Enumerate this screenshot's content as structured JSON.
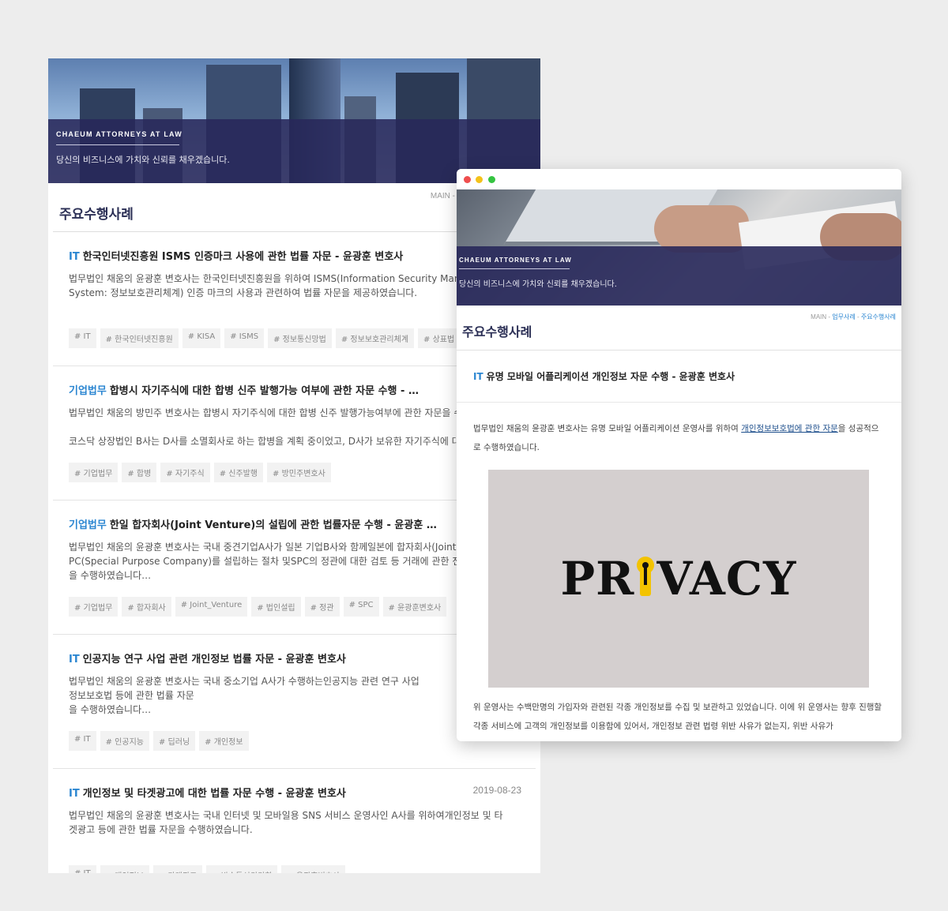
{
  "back": {
    "hero_kicker": "CHAEUM ATTORNEYS AT LAW",
    "hero_tagline": "당신의 비즈니스에 가치와 신뢰를 채우겠습니다.",
    "breadcrumb": "MAIN -",
    "page_title": "주요수행사례",
    "posts": [
      {
        "category": "IT",
        "title": "한국인터넷진흥원 ISMS 인증마크 사용에 관한 법률 자문 - 윤광훈 변호사",
        "date": "",
        "excerpt": "법무법인 채움의 윤광훈 변호사는 한국인터넷진흥원을 위하여 ISMS(Information Security Mana\nSystem: 정보보호관리체계) 인증 마크의 사용과 관련하여 법률 자문을 제공하였습니다.",
        "tags": [
          "# IT",
          "# 한국인터넷진흥원",
          "# KISA",
          "# ISMS",
          "# 정보통신망법",
          "# 정보보호관리체계",
          "# 상표법"
        ]
      },
      {
        "category": "기업법무",
        "title": "합병시 자기주식에 대한 합병 신주 발행가능 여부에 관한 자문 수행 - …",
        "date": "",
        "excerpt": "법무법인 채움의 방민주 변호사는 합병시 자기주식에 대한 합병 신주 발행가능여부에 관한 자문을 수\n\n코스닥 상장법인 B사는 D사를 소멸회사로 하는 합병을 계획 중이었고, D사가 보유한 자기주식에 대",
        "tags": [
          "# 기업법무",
          "# 합병",
          "# 자기주식",
          "# 신주발행",
          "# 방민주변호사"
        ]
      },
      {
        "category": "기업법무",
        "title": "한일 합자회사(Joint Venture)의 설립에 관한 법률자문 수행 - 윤광훈 …",
        "date": "",
        "excerpt": "법무법인 채움의 윤광훈 변호사는 국내 중견기업A사가 일본 기업B사와 함께일본에 합자회사(Joint\nPC(Special Purpose Company)를 설립하는 절차 및SPC의 정관에 대한 검토 등 거래에 관한 전반\n을 수행하였습니다…",
        "tags": [
          "# 기업법무",
          "# 합자회사",
          "# Joint_Venture",
          "# 법인설립",
          "# 정관",
          "# SPC",
          "# 윤광훈변호사"
        ]
      },
      {
        "category": "IT",
        "title": "인공지능 연구 사업 관련 개인정보 법률 자문 - 윤광훈 변호사",
        "date": "",
        "excerpt": "법무법인 채움의 윤광훈 변호사는 국내 중소기업 A사가 수행하는인공지능 관련 연구 사업\n정보보호법 등에 관한 법률 자문\n을 수행하였습니다…",
        "tags": [
          "# IT",
          "# 인공지능",
          "# 딥러닝",
          "# 개인정보"
        ]
      },
      {
        "category": "IT",
        "title": "개인정보 및 타겟광고에 대한 법률 자문 수행 - 윤광훈 변호사",
        "date": "2019-08-23",
        "excerpt": "법무법인 채움의 윤광훈 변호사는 국내 인터넷 및 모바일용 SNS 서비스 운영사인 A사를 위하여개인정보 및 타\n겟광고 등에 관한 법률 자문을 수행하였습니다.",
        "tags": [
          "# IT",
          "# 개인정보",
          "# 타겟광고",
          "# 방송통신위원회",
          "# 윤광훈변호사"
        ]
      }
    ]
  },
  "front": {
    "hero_kicker": "CHAEUM ATTORNEYS AT LAW",
    "hero_tagline": "당신의 비즈니스에 가치와 신뢰를 채우겠습니다.",
    "breadcrumb": {
      "home": "MAIN",
      "sep": " - ",
      "section": "업무사례",
      "current": "주요수행사례"
    },
    "page_title": "주요수행사례",
    "post_category": "IT",
    "post_title": "유명 모바일 어플리케이션 개인정보 자문 수행 - 윤광훈 변호사",
    "body_1_pre": "법무법인 채움의 윤광훈 변호사는 유명 모바일 어플리케이션 운영사를 위하여 ",
    "body_1_link": "개인정보보호법에 관한 자문",
    "body_1_post": "을 성공적으로 수행하였습니다.",
    "image_word_left": "PR",
    "image_word_right": "VACY",
    "body_2": "위 운영사는 수백만명의 가입자와 관련된 각종 개인정보를 수집 및 보관하고 있었습니다. 이에 위 운영사는 향후 진행할 각종 서비스에 고객의 개인정보를 이용함에 있어서, 개인정보 관련 법령 위반 사유가 없는지, 위반 사유가"
  },
  "colors": {
    "accent": "#2b86d1",
    "navy_band": "#28285a",
    "title": "#2b2f55",
    "keyhole": "#f3c300"
  }
}
